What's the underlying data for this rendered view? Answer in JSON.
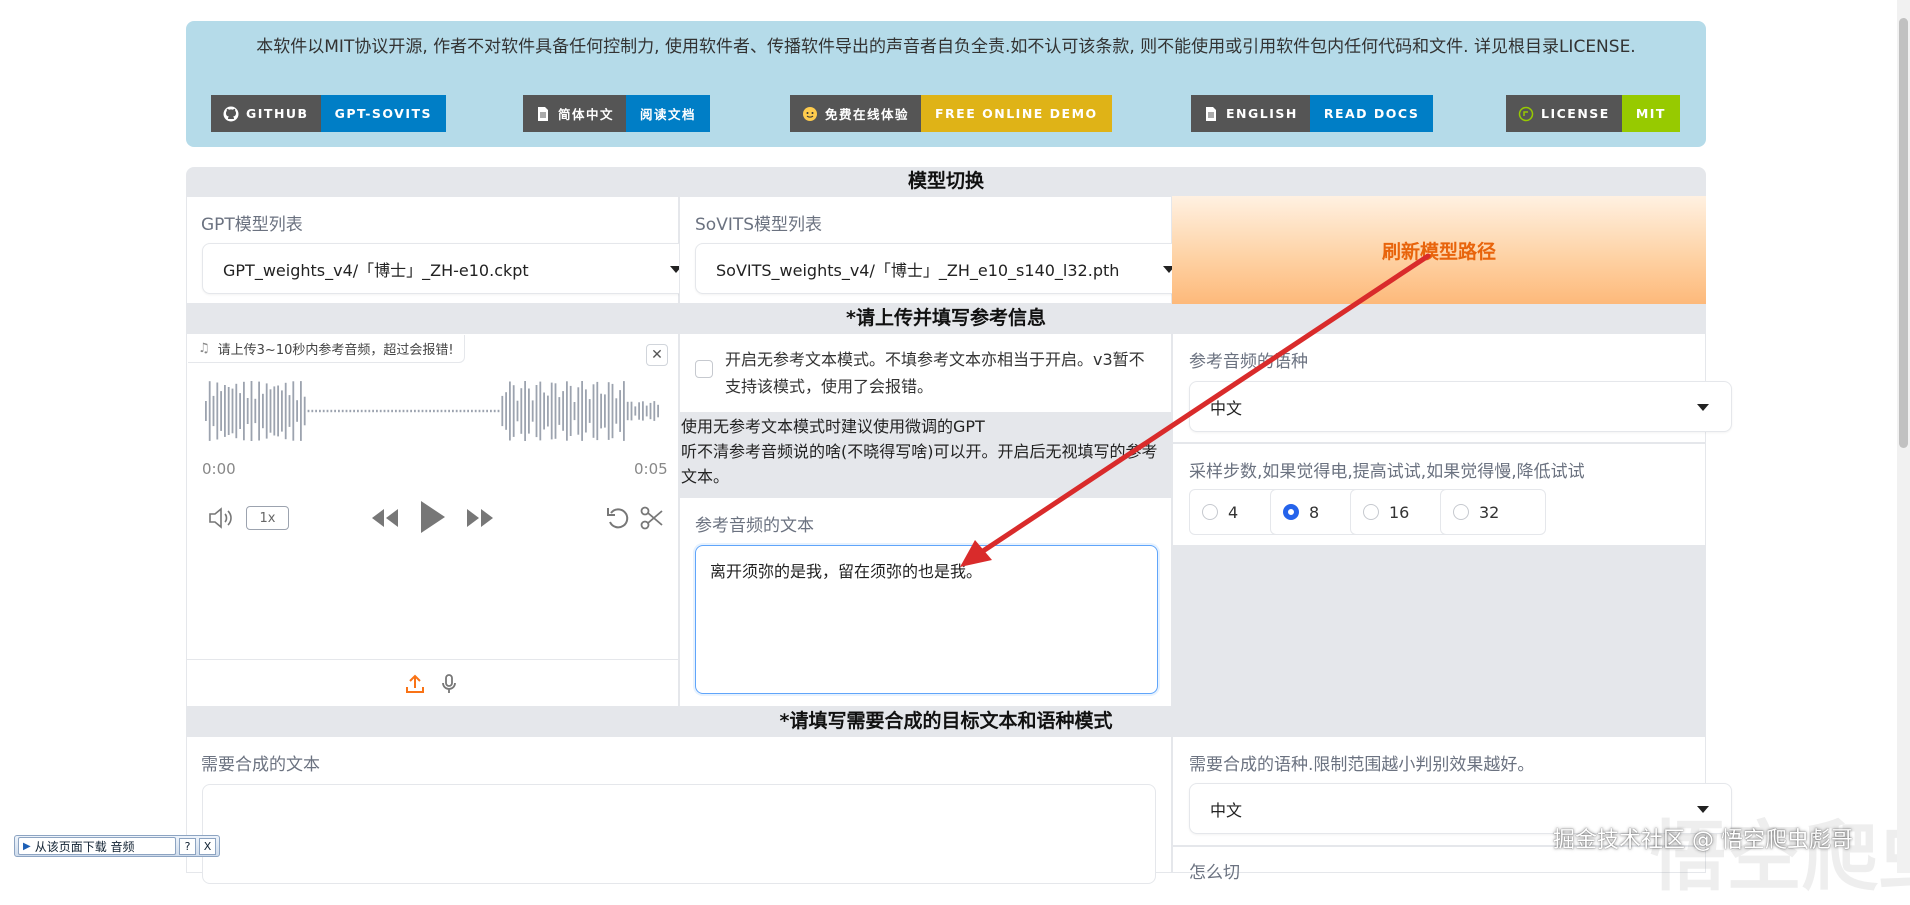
{
  "banner": {
    "text": "本软件以MIT协议开源, 作者不对软件具备任何控制力, 使用软件者、传播软件导出的声音者自负全责.如不认可该条款, 则不能使用或引用软件包内任何代码和文件. 详见根目录LICENSE.",
    "badges": [
      {
        "left": "GITHUB",
        "right": "GPT-SOVITS",
        "color": "#007ec6",
        "icon": "github-icon"
      },
      {
        "left": "简体中文",
        "right": "阅读文档",
        "color": "#007ec6",
        "icon": "document-icon"
      },
      {
        "left": "免费在线体验",
        "right": "FREE ONLINE DEMO",
        "color": "#dfb317",
        "icon": "huggingface-icon"
      },
      {
        "left": "ENGLISH",
        "right": "READ DOCS",
        "color": "#007ec6",
        "icon": "document-icon"
      },
      {
        "left": "LICENSE",
        "right": "MIT",
        "color": "#97ca00",
        "icon": "license-icon"
      }
    ]
  },
  "model_section": {
    "title": "模型切换",
    "gpt_label": "GPT模型列表",
    "gpt_value": "GPT_weights_v4/「博士」_ZH-e10.ckpt",
    "sovits_label": "SoVITS模型列表",
    "sovits_value": "SoVITS_weights_v4/「博士」_ZH_e10_s140_l32.pth",
    "refresh_button": "刷新模型路径"
  },
  "reference_section": {
    "title": "*请上传并填写参考信息",
    "audio_label": "请上传3~10秒内参考音频，超过会报错!",
    "time_start": "0:00",
    "time_end": "0:05",
    "speed": "1x",
    "no_ref_checkbox": "开启无参考文本模式。不填参考文本亦相当于开启。v3暂不支持该模式，使用了会报错。",
    "hint_line1": "使用无参考文本模式时建议使用微调的GPT",
    "hint_line2": "听不清参考音频说的啥(不晓得写啥)可以开。开启后无视填写的参考文本。",
    "ref_text_label": "参考音频的文本",
    "ref_text_value": "离开须弥的是我，留在须弥的也是我。",
    "ref_lang_label": "参考音频的语种",
    "ref_lang_value": "中文",
    "steps_label": "采样步数,如果觉得电,提高试试,如果觉得慢,降低试试",
    "steps_options": [
      "4",
      "8",
      "16",
      "32"
    ],
    "steps_selected": "8"
  },
  "target_section": {
    "title": "*请填写需要合成的目标文本和语种模式",
    "target_text_label": "需要合成的文本",
    "target_lang_label": "需要合成的语种.限制范围越小判别效果越好。",
    "target_lang_value": "中文",
    "cut_label": "怎么切"
  },
  "download_bar": {
    "label": "从该页面下载 音频",
    "help": "?",
    "close": "X"
  },
  "watermark": {
    "text": "掘金技术社区 @ 悟空爬虫彪哥",
    "big": "悟空爬虫"
  },
  "colors": {
    "annotation_arrow": "#d92b2b",
    "refresh_text": "#e8640c",
    "accent_blue": "#2563eb",
    "upload_orange": "#f97316"
  }
}
